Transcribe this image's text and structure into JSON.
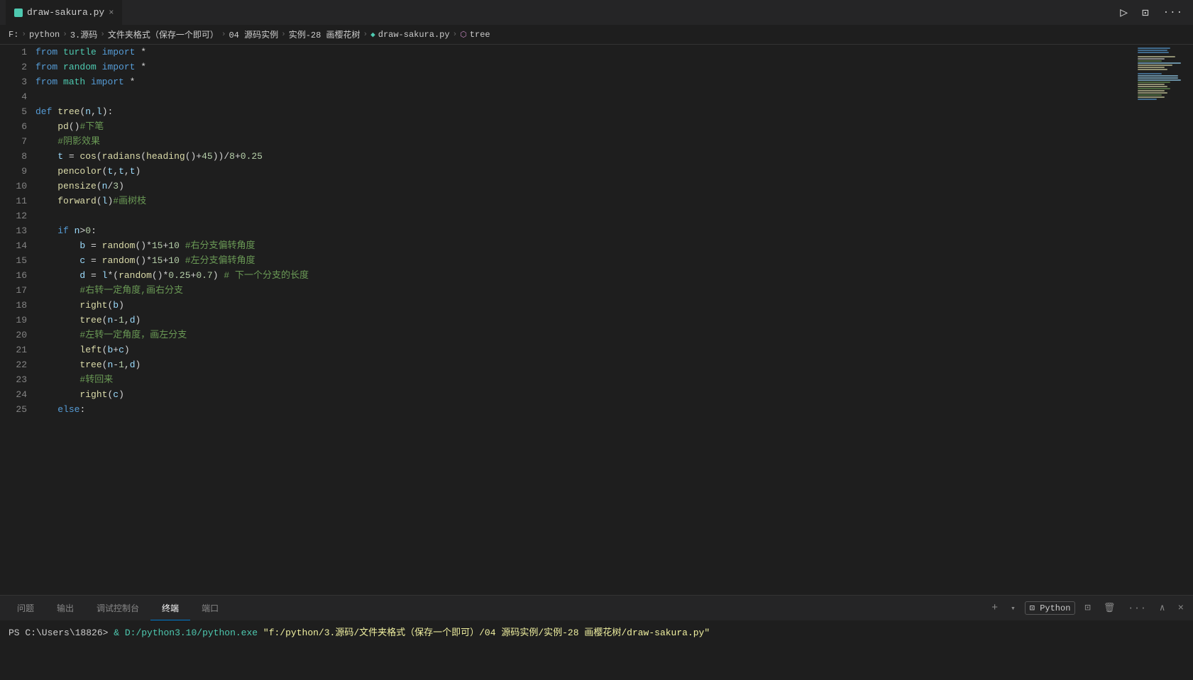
{
  "titleBar": {
    "tab": {
      "icon": "python-icon",
      "label": "draw-sakura.py",
      "close": "×"
    },
    "actions": {
      "run": "▷",
      "split": "⊡",
      "more": "···"
    }
  },
  "breadcrumb": {
    "items": [
      "F:",
      "python",
      "3.源码",
      "文件夹格式（保存一个即可）",
      "04 源码实例",
      "实例-28 画樱花树",
      "draw-sakura.py",
      "tree"
    ]
  },
  "editor": {
    "lines": [
      {
        "num": 1,
        "tokens": [
          {
            "t": "from ",
            "c": "kw"
          },
          {
            "t": "turtle",
            "c": "cn"
          },
          {
            "t": " import ",
            "c": "kw"
          },
          {
            "t": "*",
            "c": "plain"
          }
        ]
      },
      {
        "num": 2,
        "tokens": [
          {
            "t": "from ",
            "c": "kw"
          },
          {
            "t": "random",
            "c": "cn"
          },
          {
            "t": " import ",
            "c": "kw"
          },
          {
            "t": "*",
            "c": "plain"
          }
        ]
      },
      {
        "num": 3,
        "tokens": [
          {
            "t": "from ",
            "c": "kw"
          },
          {
            "t": "math",
            "c": "cn"
          },
          {
            "t": " import ",
            "c": "kw"
          },
          {
            "t": "*",
            "c": "plain"
          }
        ]
      },
      {
        "num": 4,
        "tokens": []
      },
      {
        "num": 5,
        "tokens": [
          {
            "t": "def ",
            "c": "kw"
          },
          {
            "t": "tree",
            "c": "fn"
          },
          {
            "t": "(",
            "c": "punct"
          },
          {
            "t": "n",
            "c": "var"
          },
          {
            "t": ",",
            "c": "punct"
          },
          {
            "t": "l",
            "c": "var"
          },
          {
            "t": "):",
            "c": "punct"
          }
        ]
      },
      {
        "num": 6,
        "tokens": [
          {
            "t": "    ",
            "c": "plain"
          },
          {
            "t": "pd",
            "c": "fn"
          },
          {
            "t": "()",
            "c": "punct"
          },
          {
            "t": "#下笔",
            "c": "cm"
          }
        ]
      },
      {
        "num": 7,
        "tokens": [
          {
            "t": "    ",
            "c": "plain"
          },
          {
            "t": "#阴影效果",
            "c": "cm"
          }
        ]
      },
      {
        "num": 8,
        "tokens": [
          {
            "t": "    ",
            "c": "plain"
          },
          {
            "t": "t",
            "c": "var"
          },
          {
            "t": " = ",
            "c": "plain"
          },
          {
            "t": "cos",
            "c": "fn"
          },
          {
            "t": "(",
            "c": "punct"
          },
          {
            "t": "radians",
            "c": "fn"
          },
          {
            "t": "(",
            "c": "punct"
          },
          {
            "t": "heading",
            "c": "fn"
          },
          {
            "t": "()",
            "c": "punct"
          },
          {
            "t": "+",
            "c": "op"
          },
          {
            "t": "45",
            "c": "num"
          },
          {
            "t": "))",
            "c": "punct"
          },
          {
            "t": "/",
            "c": "op"
          },
          {
            "t": "8",
            "c": "num"
          },
          {
            "t": "+",
            "c": "op"
          },
          {
            "t": "0.25",
            "c": "num"
          }
        ]
      },
      {
        "num": 9,
        "tokens": [
          {
            "t": "    ",
            "c": "plain"
          },
          {
            "t": "pencolor",
            "c": "fn"
          },
          {
            "t": "(",
            "c": "punct"
          },
          {
            "t": "t",
            "c": "var"
          },
          {
            "t": ",",
            "c": "punct"
          },
          {
            "t": "t",
            "c": "var"
          },
          {
            "t": ",",
            "c": "punct"
          },
          {
            "t": "t",
            "c": "var"
          },
          {
            "t": ")",
            "c": "punct"
          }
        ]
      },
      {
        "num": 10,
        "tokens": [
          {
            "t": "    ",
            "c": "plain"
          },
          {
            "t": "pensize",
            "c": "fn"
          },
          {
            "t": "(",
            "c": "punct"
          },
          {
            "t": "n",
            "c": "var"
          },
          {
            "t": "/",
            "c": "op"
          },
          {
            "t": "3",
            "c": "num"
          },
          {
            "t": ")",
            "c": "punct"
          }
        ]
      },
      {
        "num": 11,
        "tokens": [
          {
            "t": "    ",
            "c": "plain"
          },
          {
            "t": "forward",
            "c": "fn"
          },
          {
            "t": "(",
            "c": "punct"
          },
          {
            "t": "l",
            "c": "var"
          },
          {
            "t": ")",
            "c": "punct"
          },
          {
            "t": "#画树枝",
            "c": "cm"
          }
        ]
      },
      {
        "num": 12,
        "tokens": []
      },
      {
        "num": 13,
        "tokens": [
          {
            "t": "    ",
            "c": "plain"
          },
          {
            "t": "if ",
            "c": "kw"
          },
          {
            "t": "n",
            "c": "var"
          },
          {
            "t": ">",
            "c": "op"
          },
          {
            "t": "0",
            "c": "num"
          },
          {
            "t": ":",
            "c": "punct"
          }
        ]
      },
      {
        "num": 14,
        "tokens": [
          {
            "t": "        ",
            "c": "plain"
          },
          {
            "t": "b",
            "c": "var"
          },
          {
            "t": " = ",
            "c": "plain"
          },
          {
            "t": "random",
            "c": "fn"
          },
          {
            "t": "()",
            "c": "punct"
          },
          {
            "t": "*",
            "c": "op"
          },
          {
            "t": "15",
            "c": "num"
          },
          {
            "t": "+",
            "c": "op"
          },
          {
            "t": "10",
            "c": "num"
          },
          {
            "t": " ",
            "c": "plain"
          },
          {
            "t": "#右分支偏转角度",
            "c": "cm"
          }
        ]
      },
      {
        "num": 15,
        "tokens": [
          {
            "t": "        ",
            "c": "plain"
          },
          {
            "t": "c",
            "c": "var"
          },
          {
            "t": " = ",
            "c": "plain"
          },
          {
            "t": "random",
            "c": "fn"
          },
          {
            "t": "()",
            "c": "punct"
          },
          {
            "t": "*",
            "c": "op"
          },
          {
            "t": "15",
            "c": "num"
          },
          {
            "t": "+",
            "c": "op"
          },
          {
            "t": "10",
            "c": "num"
          },
          {
            "t": " ",
            "c": "plain"
          },
          {
            "t": "#左分支偏转角度",
            "c": "cm"
          }
        ]
      },
      {
        "num": 16,
        "tokens": [
          {
            "t": "        ",
            "c": "plain"
          },
          {
            "t": "d",
            "c": "var"
          },
          {
            "t": " = ",
            "c": "plain"
          },
          {
            "t": "l",
            "c": "var"
          },
          {
            "t": "*(",
            "c": "punct"
          },
          {
            "t": "random",
            "c": "fn"
          },
          {
            "t": "()",
            "c": "punct"
          },
          {
            "t": "*",
            "c": "op"
          },
          {
            "t": "0.25",
            "c": "num"
          },
          {
            "t": "+",
            "c": "op"
          },
          {
            "t": "0.7",
            "c": "num"
          },
          {
            "t": ") ",
            "c": "punct"
          },
          {
            "t": "# 下一个分支的长度",
            "c": "cm"
          }
        ]
      },
      {
        "num": 17,
        "tokens": [
          {
            "t": "        ",
            "c": "plain"
          },
          {
            "t": "#右转一定角度,画右分支",
            "c": "cm"
          }
        ]
      },
      {
        "num": 18,
        "tokens": [
          {
            "t": "        ",
            "c": "plain"
          },
          {
            "t": "right",
            "c": "fn"
          },
          {
            "t": "(",
            "c": "punct"
          },
          {
            "t": "b",
            "c": "var"
          },
          {
            "t": ")",
            "c": "punct"
          }
        ]
      },
      {
        "num": 19,
        "tokens": [
          {
            "t": "        ",
            "c": "plain"
          },
          {
            "t": "tree",
            "c": "fn"
          },
          {
            "t": "(",
            "c": "punct"
          },
          {
            "t": "n",
            "c": "var"
          },
          {
            "t": "-",
            "c": "op"
          },
          {
            "t": "1",
            "c": "num"
          },
          {
            "t": ",",
            "c": "punct"
          },
          {
            "t": "d",
            "c": "var"
          },
          {
            "t": ")",
            "c": "punct"
          }
        ]
      },
      {
        "num": 20,
        "tokens": [
          {
            "t": "        ",
            "c": "plain"
          },
          {
            "t": "#左转一定角度，画左分支",
            "c": "cm"
          }
        ]
      },
      {
        "num": 21,
        "tokens": [
          {
            "t": "        ",
            "c": "plain"
          },
          {
            "t": "left",
            "c": "fn"
          },
          {
            "t": "(",
            "c": "punct"
          },
          {
            "t": "b",
            "c": "var"
          },
          {
            "t": "+",
            "c": "op"
          },
          {
            "t": "c",
            "c": "var"
          },
          {
            "t": ")",
            "c": "punct"
          }
        ]
      },
      {
        "num": 22,
        "tokens": [
          {
            "t": "        ",
            "c": "plain"
          },
          {
            "t": "tree",
            "c": "fn"
          },
          {
            "t": "(",
            "c": "punct"
          },
          {
            "t": "n",
            "c": "var"
          },
          {
            "t": "-",
            "c": "op"
          },
          {
            "t": "1",
            "c": "num"
          },
          {
            "t": ",",
            "c": "punct"
          },
          {
            "t": "d",
            "c": "var"
          },
          {
            "t": ")",
            "c": "punct"
          }
        ]
      },
      {
        "num": 23,
        "tokens": [
          {
            "t": "        ",
            "c": "plain"
          },
          {
            "t": "#转回来",
            "c": "cm"
          }
        ]
      },
      {
        "num": 24,
        "tokens": [
          {
            "t": "        ",
            "c": "plain"
          },
          {
            "t": "right",
            "c": "fn"
          },
          {
            "t": "(",
            "c": "punct"
          },
          {
            "t": "c",
            "c": "var"
          },
          {
            "t": ")",
            "c": "punct"
          }
        ]
      },
      {
        "num": 25,
        "tokens": [
          {
            "t": "    ",
            "c": "plain"
          },
          {
            "t": "else",
            "c": "kw"
          },
          {
            "t": ":",
            "c": "punct"
          }
        ]
      }
    ]
  },
  "bottomPanel": {
    "tabs": [
      "问题",
      "输出",
      "调试控制台",
      "终端",
      "端口"
    ],
    "activeTab": "终端",
    "actions": {
      "add": "+",
      "python": "Python",
      "split": "⊡",
      "trash": "🗑",
      "more": "···",
      "chevronUp": "^",
      "close": "×"
    },
    "terminal": {
      "prompt": "PS C:\\Users\\18826>",
      "command": " & D:/python3.10/python.exe",
      "path": " \"f:/python/3.源码/文件夹格式（保存一个即可）/04 源码实例/实例-28 画樱花树/draw-sakura.py\""
    }
  },
  "minimap": {
    "lines": [
      {
        "color": "#569cd6",
        "width": 60
      },
      {
        "color": "#569cd6",
        "width": 55
      },
      {
        "color": "#569cd6",
        "width": 58
      },
      {
        "color": "#1e1e1e",
        "width": 0
      },
      {
        "color": "#dcdcaa",
        "width": 70
      },
      {
        "color": "#d4d4d4",
        "width": 50
      },
      {
        "color": "#6a9955",
        "width": 45
      },
      {
        "color": "#9cdcfe",
        "width": 80
      },
      {
        "color": "#dcdcaa",
        "width": 65
      },
      {
        "color": "#dcdcaa",
        "width": 50
      },
      {
        "color": "#dcdcaa",
        "width": 55
      },
      {
        "color": "#1e1e1e",
        "width": 0
      },
      {
        "color": "#569cd6",
        "width": 45
      },
      {
        "color": "#9cdcfe",
        "width": 75
      },
      {
        "color": "#9cdcfe",
        "width": 75
      },
      {
        "color": "#9cdcfe",
        "width": 80
      },
      {
        "color": "#6a9955",
        "width": 60
      },
      {
        "color": "#dcdcaa",
        "width": 50
      },
      {
        "color": "#dcdcaa",
        "width": 55
      },
      {
        "color": "#6a9955",
        "width": 60
      },
      {
        "color": "#dcdcaa",
        "width": 50
      },
      {
        "color": "#dcdcaa",
        "width": 55
      },
      {
        "color": "#6a9955",
        "width": 45
      },
      {
        "color": "#dcdcaa",
        "width": 50
      },
      {
        "color": "#569cd6",
        "width": 35
      }
    ]
  }
}
